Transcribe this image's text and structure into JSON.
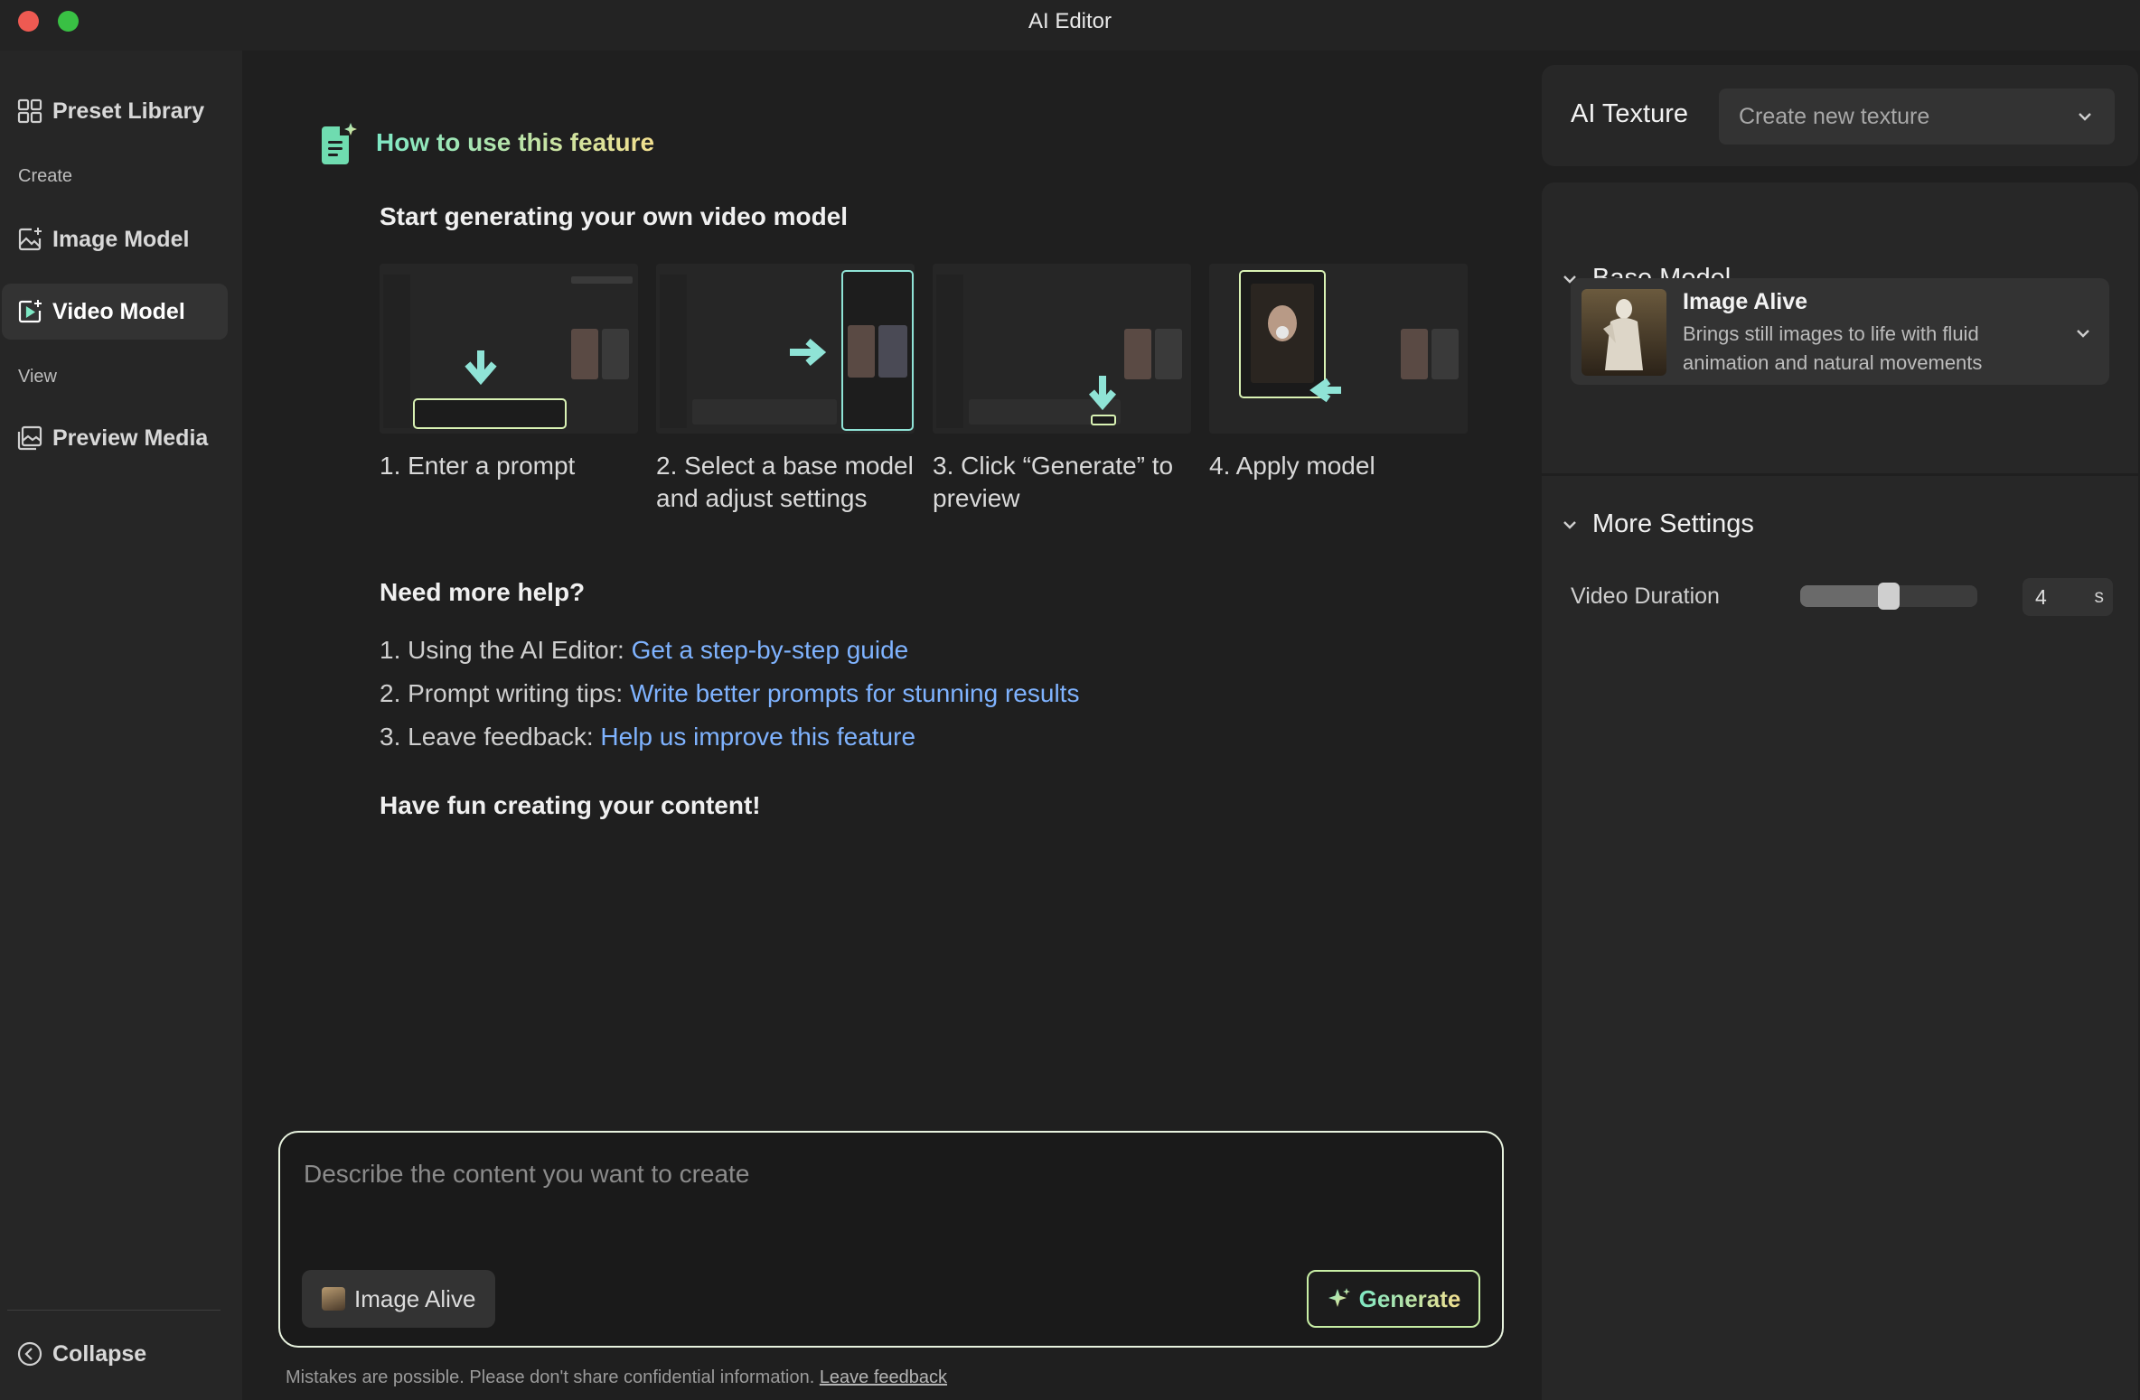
{
  "window": {
    "title": "AI Editor"
  },
  "sidebar": {
    "preset_library": "Preset Library",
    "section_create": "Create",
    "image_model": "Image Model",
    "video_model": "Video Model",
    "section_view": "View",
    "preview_media": "Preview Media",
    "collapse": "Collapse",
    "active_item": "Video Model"
  },
  "help": {
    "title": "How to use this feature",
    "subtitle": "Start generating your own video model",
    "steps": [
      {
        "label": "1. Enter a prompt"
      },
      {
        "label": "2. Select a base model and adjust settings"
      },
      {
        "label": "3. Click “Generate” to preview"
      },
      {
        "label": "4. Apply model"
      }
    ],
    "more_help_heading": "Need more help?",
    "links": [
      {
        "prefix": "1. Using the AI Editor: ",
        "link": "Get a step-by-step guide"
      },
      {
        "prefix": "2. Prompt writing tips: ",
        "link": "Write better prompts for stunning results"
      },
      {
        "prefix": "3. Leave feedback: ",
        "link": "Help us improve this feature"
      }
    ],
    "closing": "Have fun creating your content!"
  },
  "composer": {
    "placeholder": "Describe the content you want to create",
    "value": "",
    "model_chip": "Image Alive",
    "generate_label": "Generate"
  },
  "footer": {
    "disclaimer": "Mistakes are possible. Please don't share confidential information.",
    "feedback_link": "Leave feedback"
  },
  "right_panel": {
    "texture_label": "AI Texture",
    "texture_select": "Create new texture",
    "base_model_heading": "Base Model",
    "model": {
      "name": "Image Alive",
      "description": "Brings still images to life with fluid animation and natural movements"
    },
    "more_settings_heading": "More Settings",
    "video_duration_label": "Video Duration",
    "video_duration_value": "4",
    "video_duration_unit": "s",
    "video_duration_slider_fraction": 0.5
  },
  "colors": {
    "accent_gradient_start": "#7ee8c4",
    "accent_gradient_end": "#f3e08f",
    "link": "#7fb3ff",
    "traffic_red": "#ee5a52",
    "traffic_green": "#39c044"
  }
}
